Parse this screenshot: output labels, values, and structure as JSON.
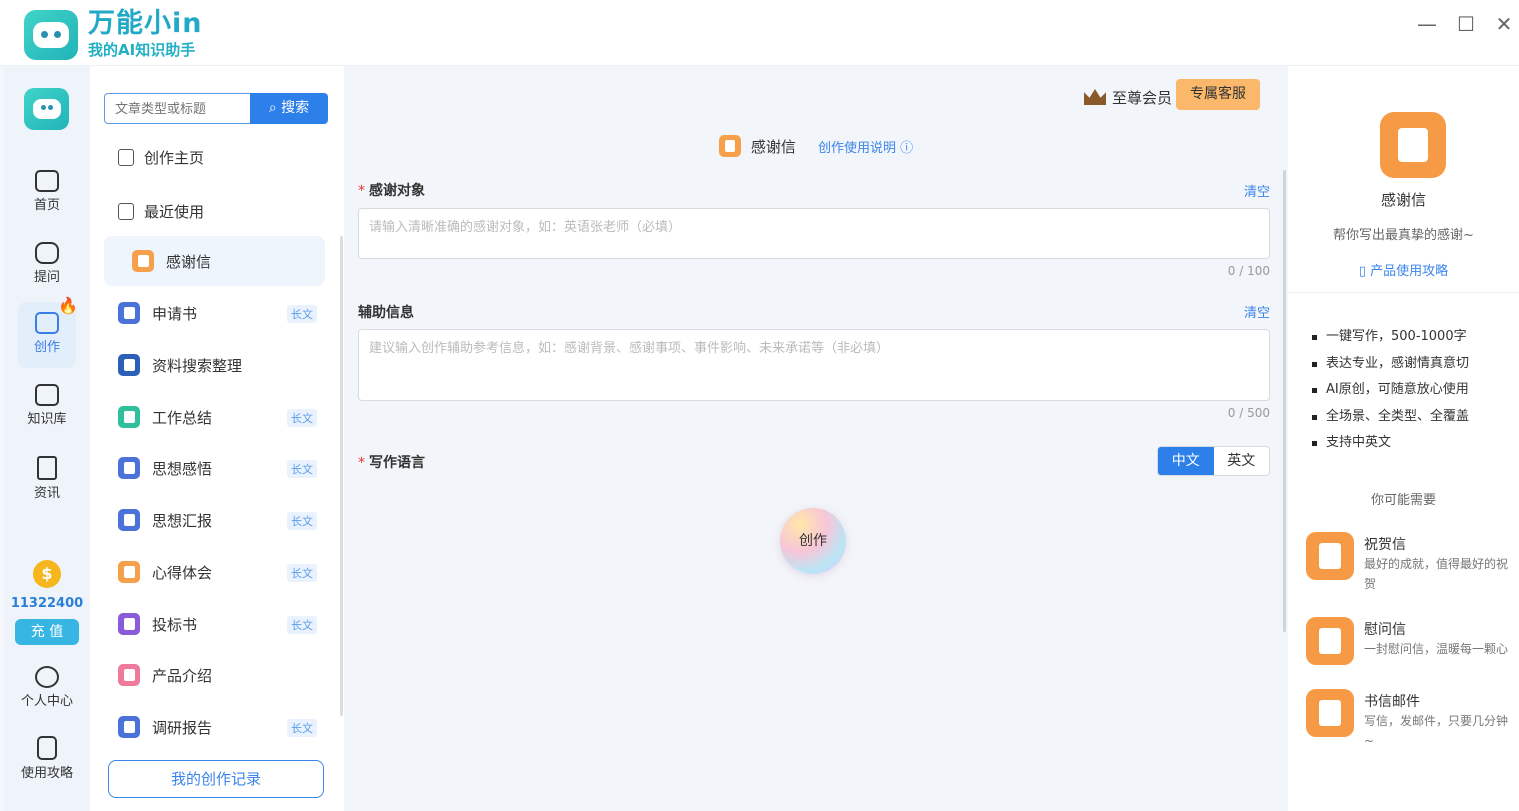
{
  "app": {
    "name": "万能小in",
    "tagline": "我的AI知识助手"
  },
  "window_controls": {
    "minimize": "—",
    "maximize": "☐",
    "close": "✕"
  },
  "sidebar": {
    "nav": [
      {
        "label": "首页"
      },
      {
        "label": "提问"
      },
      {
        "label": "创作"
      },
      {
        "label": "知识库"
      },
      {
        "label": "资讯"
      },
      {
        "label": "个人中心"
      },
      {
        "label": "使用攻略"
      }
    ],
    "coin_symbol": "$",
    "credits": "11322400",
    "recharge_label": "充 值"
  },
  "menu": {
    "search_placeholder": "文章类型或标题",
    "search_button": "搜索",
    "home_label": "创作主页",
    "recent_label": "最近使用",
    "items": [
      {
        "label": "感谢信",
        "tag": "",
        "color": "#f7a04b"
      },
      {
        "label": "申请书",
        "tag": "长文",
        "color": "#4a72d9"
      },
      {
        "label": "资料搜索整理",
        "tag": "",
        "color": "#2b5fb8"
      },
      {
        "label": "工作总结",
        "tag": "长文",
        "color": "#2fbf9a"
      },
      {
        "label": "思想感悟",
        "tag": "长文",
        "color": "#4a72d9"
      },
      {
        "label": "思想汇报",
        "tag": "长文",
        "color": "#4a72d9"
      },
      {
        "label": "心得体会",
        "tag": "长文",
        "color": "#f7a04b"
      },
      {
        "label": "投标书",
        "tag": "长文",
        "color": "#8a5ad9"
      },
      {
        "label": "产品介绍",
        "tag": "",
        "color": "#f07a9a"
      },
      {
        "label": "调研报告",
        "tag": "长文",
        "color": "#4a72d9"
      }
    ],
    "record_button": "我的创作记录"
  },
  "main": {
    "vip_label": "至尊会员",
    "service_button": "专属客服",
    "title": "感谢信",
    "help_link": "创作使用说明 ⓘ",
    "fields": {
      "target": {
        "label": "感谢对象",
        "placeholder": "请输入清晰准确的感谢对象，如：英语张老师（必填）",
        "counter": "0 / 100",
        "clear": "清空"
      },
      "extra": {
        "label": "辅助信息",
        "placeholder": "建议输入创作辅助参考信息，如：感谢背景、感谢事项、事件影响、未来承诺等（非必填）",
        "counter": "0 / 500",
        "clear": "清空"
      },
      "language": {
        "label": "写作语言",
        "options": [
          "中文",
          "英文"
        ],
        "selected": "中文"
      }
    },
    "create_button": "创作"
  },
  "right_panel": {
    "title": "感谢信",
    "subtitle": "帮你写出最真挚的感谢~",
    "guide_link": "产品使用攻略",
    "features": [
      "一键写作，500-1000字",
      "表达专业，感谢情真意切",
      "AI原创，可随意放心使用",
      "全场景、全类型、全覆盖",
      "支持中英文"
    ],
    "maybe_need": "你可能需要",
    "recommendations": [
      {
        "title": "祝贺信",
        "desc": "最好的成就，值得最好的祝贺"
      },
      {
        "title": "慰问信",
        "desc": "一封慰问信，温暖每一颗心"
      },
      {
        "title": "书信邮件",
        "desc": "写信，发邮件，只要几分钟~"
      }
    ]
  }
}
